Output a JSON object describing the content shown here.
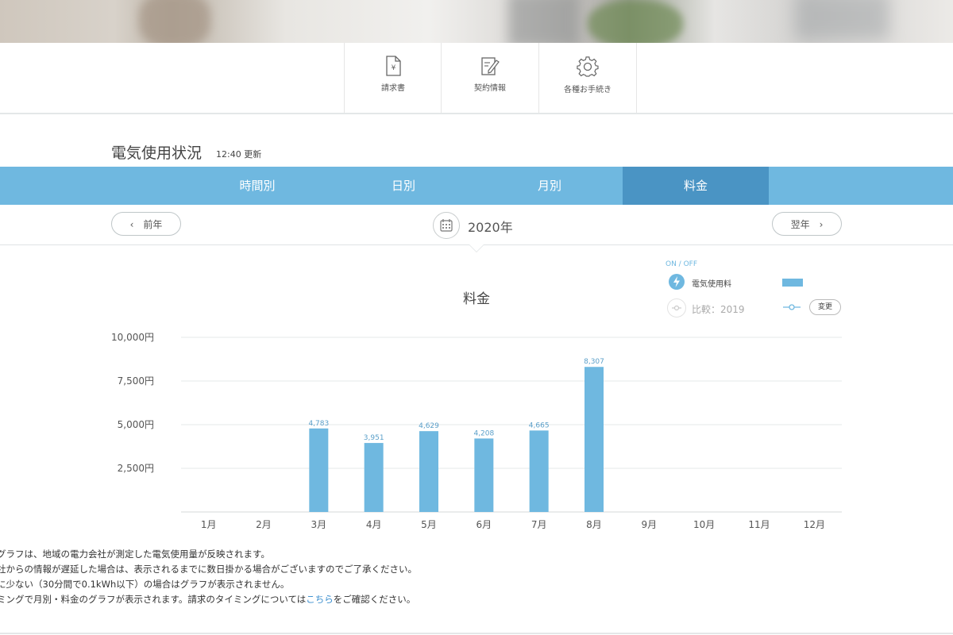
{
  "top_menu": {
    "items": [
      {
        "label": "請求書",
        "icon": "yen-document-icon"
      },
      {
        "label": "契約情報",
        "icon": "contract-edit-icon"
      },
      {
        "label": "各種お手続き",
        "icon": "gear-icon"
      }
    ]
  },
  "section": {
    "title": "電気使用状況",
    "updated": "12:40 更新"
  },
  "tabs": [
    {
      "label": "時間別",
      "active": false
    },
    {
      "label": "日別",
      "active": false
    },
    {
      "label": "月別",
      "active": false
    },
    {
      "label": "料金",
      "active": true
    }
  ],
  "year_nav": {
    "prev_label": "前年",
    "current_year": "2020年",
    "next_label": "翌年"
  },
  "legend": {
    "onoff_label": "ON / OFF",
    "usage_label": "電気使用料",
    "compare_label": "比較：2019",
    "change_button": "変更"
  },
  "colors": {
    "accent": "#6fb8e0",
    "active_tab": "#4a94c4"
  },
  "chart_data": {
    "type": "bar",
    "title": "料金",
    "categories": [
      "1月",
      "2月",
      "3月",
      "4月",
      "5月",
      "6月",
      "7月",
      "8月",
      "9月",
      "10月",
      "11月",
      "12月"
    ],
    "values": [
      null,
      null,
      4783,
      3951,
      4629,
      4208,
      4665,
      8307,
      null,
      null,
      null,
      null
    ],
    "value_labels": [
      "",
      "",
      "4,783",
      "3,951",
      "4,629",
      "4,208",
      "4,665",
      "8,307",
      "",
      "",
      "",
      ""
    ],
    "y_ticks": [
      "10,000円",
      "7,500円",
      "5,000円",
      "2,500円"
    ],
    "y_tick_values": [
      10000,
      7500,
      5000,
      2500
    ],
    "ylim": [
      0,
      10000
    ],
    "grid": true
  },
  "notes": {
    "line1": "グラフは、地域の電力会社が測定した電気使用量が反映されます。",
    "line2": "社からの情報が遅延した場合は、表示されるまでに数日掛かる場合がございますのでご了承ください。",
    "line3": "に少ない（30分間で0.1kWh以下）の場合はグラフが表示されません。",
    "line4_pre": "ミングで月別・料金のグラフが表示されます。請求のタイミングについては",
    "line4_link": "こちら",
    "line4_post": "をご確認ください。"
  }
}
